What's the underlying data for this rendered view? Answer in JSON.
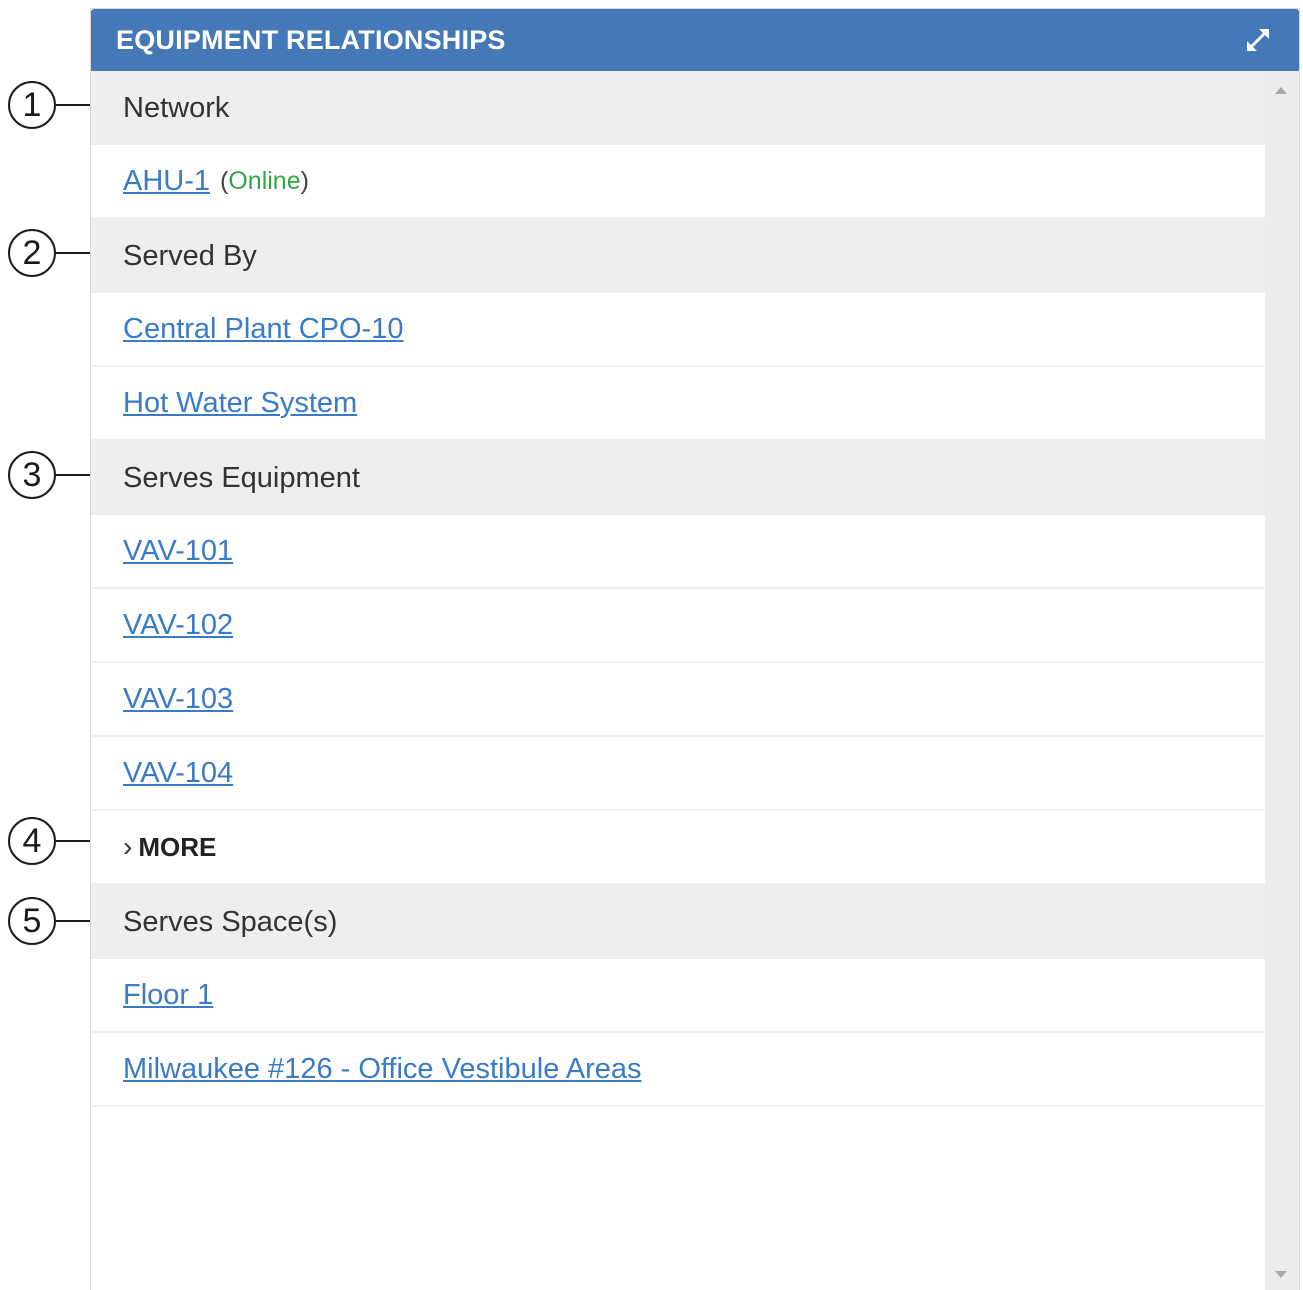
{
  "panel": {
    "title": "EQUIPMENT RELATIONSHIPS",
    "expand_icon": "expand-arrows-icon"
  },
  "sections": {
    "network": {
      "label": "Network",
      "items": [
        {
          "label": "AHU-1",
          "status_open": "(",
          "status": "Online",
          "status_close": ")"
        }
      ]
    },
    "served_by": {
      "label": "Served By",
      "items": [
        {
          "label": "Central Plant CPO-10"
        },
        {
          "label": "Hot Water System"
        }
      ]
    },
    "serves_equipment": {
      "label": "Serves Equipment",
      "items": [
        {
          "label": "VAV-101"
        },
        {
          "label": "VAV-102"
        },
        {
          "label": "VAV-103"
        },
        {
          "label": "VAV-104"
        }
      ],
      "more_label": "MORE"
    },
    "serves_spaces": {
      "label": "Serves Space(s)",
      "items": [
        {
          "label": "Floor 1"
        },
        {
          "label": "Milwaukee #126 - Office Vestibule Areas"
        }
      ]
    }
  },
  "callouts": [
    "1",
    "2",
    "3",
    "4",
    "5"
  ],
  "colors": {
    "header": "#4478b6",
    "link": "#3a7bc8",
    "online": "#2fa745",
    "section_bg": "#eeeeee"
  }
}
